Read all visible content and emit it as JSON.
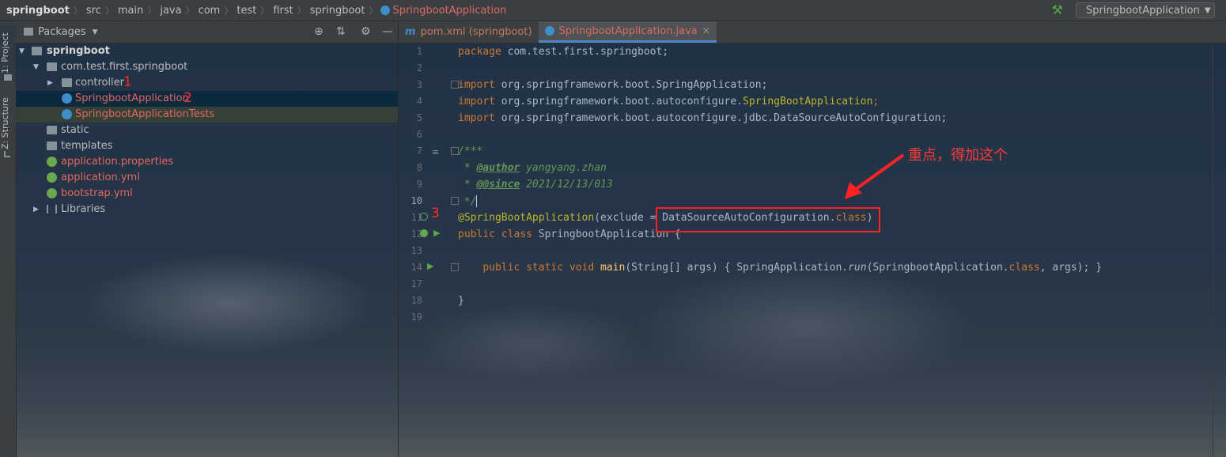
{
  "breadcrumb": {
    "items": [
      "springboot",
      "src",
      "main",
      "java",
      "com",
      "test",
      "first",
      "springboot",
      "SpringbootApplication"
    ]
  },
  "run_config": {
    "label": "SpringbootApplication"
  },
  "toolstrip": {
    "project_tab": "1: Project",
    "structure_tab": "Z: Structure"
  },
  "project_panel": {
    "title": "Packages",
    "tree": [
      {
        "label": "springboot",
        "depth": 0,
        "expanded": true,
        "type": "module"
      },
      {
        "label": "com.test.first.springboot",
        "depth": 1,
        "expanded": true,
        "type": "package"
      },
      {
        "label": "controller",
        "depth": 2,
        "expanded": false,
        "type": "package",
        "marker": "1"
      },
      {
        "label": "SpringbootApplication",
        "depth": 2,
        "type": "class",
        "selected": true,
        "marker": "2"
      },
      {
        "label": "SpringbootApplicationTests",
        "depth": 2,
        "type": "class"
      },
      {
        "label": "static",
        "depth": 1,
        "type": "folder"
      },
      {
        "label": "templates",
        "depth": 1,
        "type": "folder"
      },
      {
        "label": "application.properties",
        "depth": 1,
        "type": "config"
      },
      {
        "label": "application.yml",
        "depth": 1,
        "type": "config"
      },
      {
        "label": "bootstrap.yml",
        "depth": 1,
        "type": "config"
      },
      {
        "label": "Libraries",
        "depth": 0,
        "expanded": false,
        "type": "libraries"
      }
    ]
  },
  "editor": {
    "tabs": [
      {
        "icon": "m",
        "label": "pom.xml (springboot)",
        "active": false
      },
      {
        "label": "SpringbootApplication.java",
        "active": true
      }
    ],
    "current_line": "10",
    "gutter_marker": "3",
    "line_numbers": [
      "1",
      "2",
      "3",
      "4",
      "5",
      "6",
      "7",
      "8",
      "9",
      "10",
      "11",
      "12",
      "13",
      "14",
      "17",
      "18",
      "19"
    ],
    "code": {
      "l1_kw": "package",
      "l1_rest": " com.test.first.springboot;",
      "l3_kw": "import",
      "l3_rest": " org.springframework.boot.SpringApplication;",
      "l4_kw": "import",
      "l4_rest": " org.springframework.boot.autoconfigure.",
      "l4_anno": "SpringBootApplication",
      "l4_end": ";",
      "l5_kw": "import",
      "l5_rest": " org.springframework.boot.autoconfigure.jdbc.DataSourceAutoConfiguration;",
      "l7": "/***",
      "l8_prefix": " * ",
      "l8_tag": "@author",
      "l8_text": " yangyang.zhan",
      "l9_prefix": " * ",
      "l9_tag": "@@since",
      "l9_text": " 2021/12/13/013",
      "l10": " */",
      "l11_anno": "@SpringBootApplication",
      "l11_a": "(exclude = DataSourceAutoConfiguration.",
      "l11_kw": "class",
      "l11_b": ")",
      "l12_kw": "public class",
      "l12_rest": " SpringbootApplication {",
      "l14_kw": "public static void",
      "l14_fn": "main",
      "l14_a": "(String[] args) { SpringApplication.",
      "l14_run": "run",
      "l14_b": "(SpringbootApplication.",
      "l14_kw2": "class",
      "l14_c": ", args); }",
      "l18": "}"
    }
  },
  "annotations": {
    "callout": "重点，得加这个"
  }
}
